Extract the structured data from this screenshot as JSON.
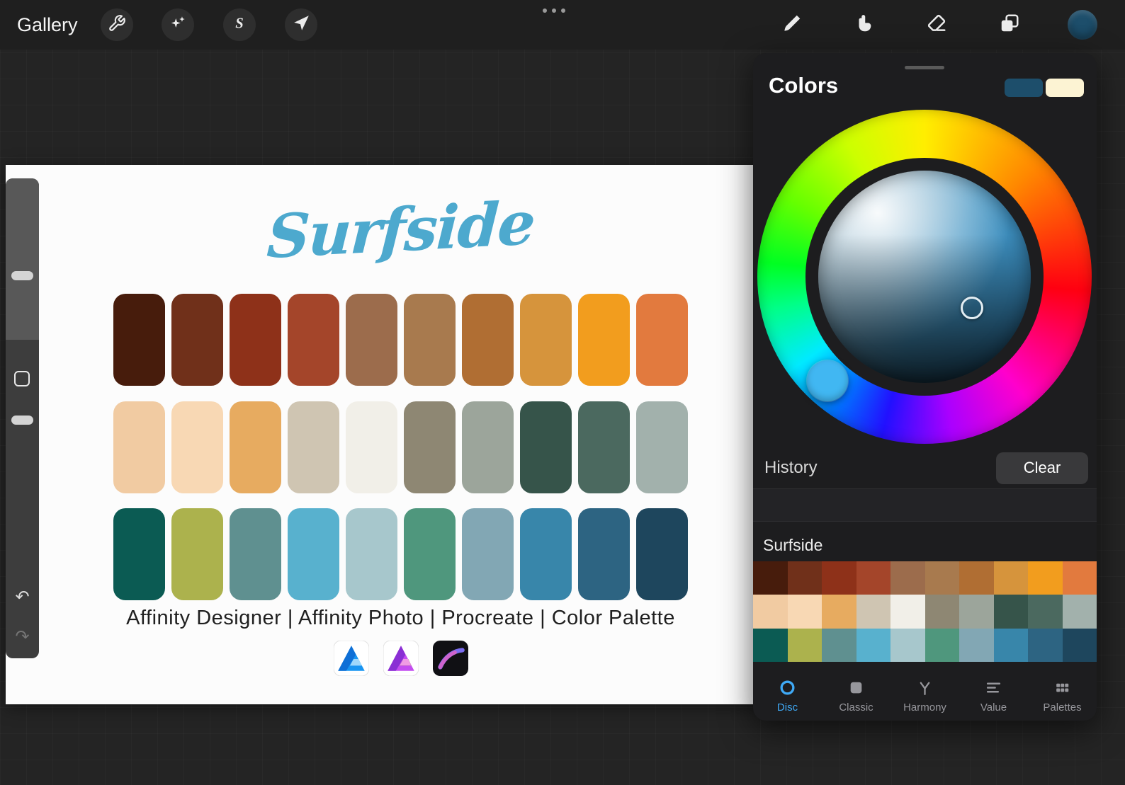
{
  "toolbar": {
    "gallery_label": "Gallery"
  },
  "icons": {
    "undo_glyph": "↶",
    "redo_glyph": "↷"
  },
  "canvas": {
    "title": "Surfside",
    "title_color": "#4da9ce",
    "caption": "Affinity Designer | Affinity Photo | Procreate | Color Palette"
  },
  "palette": {
    "name": "Surfside",
    "rows": [
      [
        "#471c0c",
        "#70301a",
        "#8e3119",
        "#a4452a",
        "#9c6c4c",
        "#a87a4e",
        "#b06e33",
        "#d6943c",
        "#f29d1e",
        "#e27a3e"
      ],
      [
        "#f1cba2",
        "#f8d8b4",
        "#e7ab60",
        "#cfc5b2",
        "#f1efe8",
        "#8e8773",
        "#9ca59b",
        "#36544a",
        "#4b695f",
        "#a2b1ac"
      ],
      [
        "#0b5b53",
        "#acb24d",
        "#5f9090",
        "#58b1ce",
        "#a7c7cc",
        "#4f977d",
        "#82a7b4",
        "#3886aa",
        "#2d6482",
        "#1e465d"
      ]
    ]
  },
  "colors_panel": {
    "title": "Colors",
    "current_color": "#1d4e6b",
    "secondary_color": "#fcf3d3",
    "history_label": "History",
    "clear_label": "Clear",
    "ring_selector_color": "#41b7f2",
    "active_tab_color": "#3fa9f5",
    "tabs": [
      {
        "label": "Disc",
        "active": true
      },
      {
        "label": "Classic",
        "active": false
      },
      {
        "label": "Harmony",
        "active": false
      },
      {
        "label": "Value",
        "active": false
      },
      {
        "label": "Palettes",
        "active": false
      }
    ]
  }
}
